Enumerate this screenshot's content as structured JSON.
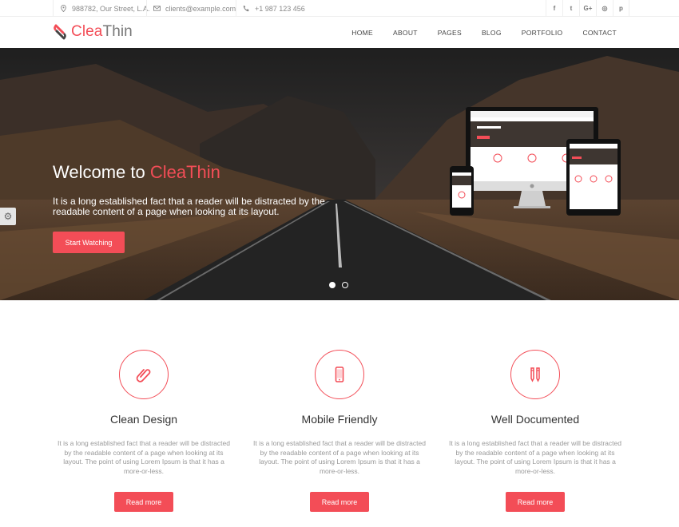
{
  "topbar": {
    "address": "988782, Our Street, L.A.",
    "email": "clients@example.com",
    "phone": "+1 987 123 456",
    "social": [
      "f",
      "t",
      "G+",
      "◎",
      "p"
    ]
  },
  "logo": {
    "part1": "Clea",
    "part2": "Thin"
  },
  "nav": [
    "HOME",
    "ABOUT",
    "PAGES",
    "BLOG",
    "PORTFOLIO",
    "CONTACT"
  ],
  "hero": {
    "title_prefix": "Welcome to ",
    "title_highlight": "CleaThin",
    "text": "It is a long established fact that a reader will be distracted by the readable content of a page when looking at its layout.",
    "button": "Start Watching"
  },
  "features": [
    {
      "icon": "paperclip-icon",
      "title": "Clean Design",
      "text": "It is a long established fact that a reader will be distracted by the readable content of a page when looking at its layout. The point of using Lorem Ipsum is that it has a more-or-less.",
      "button": "Read more"
    },
    {
      "icon": "mobile-icon",
      "title": "Mobile Friendly",
      "text": "It is a long established fact that a reader will be distracted by the readable content of a page when looking at its layout. The point of using Lorem Ipsum is that it has a more-or-less.",
      "button": "Read more"
    },
    {
      "icon": "pencils-icon",
      "title": "Well Documented",
      "text": "It is a long established fact that a reader will be distracted by the readable content of a page when looking at its layout. The point of using Lorem Ipsum is that it has a more-or-less.",
      "button": "Read more"
    }
  ],
  "colors": {
    "accent": "#f34d57"
  }
}
